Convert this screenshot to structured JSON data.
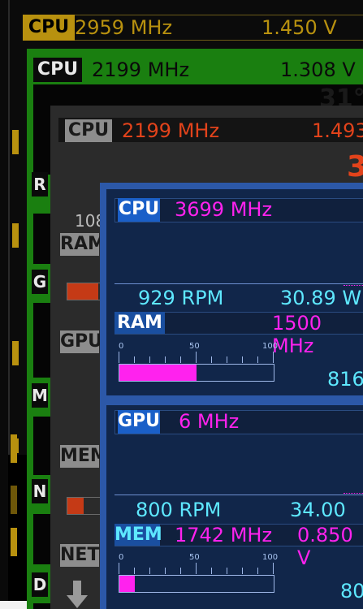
{
  "gold": {
    "cpu_label": "CPU",
    "cpu_clock": "2959 MHz",
    "cpu_voltage": "1.450 V"
  },
  "green": {
    "cpu_label": "CPU",
    "cpu_clock": "2199 MHz",
    "cpu_voltage": "1.308 V",
    "temp_partial": "31°",
    "side_letters": [
      "R",
      "G",
      "M",
      "N",
      "D"
    ]
  },
  "gray": {
    "cpu_label": "CPU",
    "cpu_clock": "2199 MHz",
    "cpu_voltage": "1.493",
    "temp_partial": "3",
    "partial_value": "108",
    "ram_label": "RAM",
    "gpu_label": "GPU",
    "mem_label": "MEM",
    "net_label": "NET",
    "ram_fill": 0.18,
    "mem_fill": 0.14
  },
  "blue": {
    "cpu_label": "CPU",
    "cpu_clock": "3699 MHz",
    "cpu_fan": "929 RPM",
    "cpu_power": "30.89 W",
    "ram_label": "RAM",
    "ram_clock": "1500 MHz",
    "ram_value_partial": "816",
    "ram_fill": 0.5,
    "gpu_label": "GPU",
    "gpu_clock": "6 MHz",
    "gpu_fan": "800 RPM",
    "gpu_power": "34.00 W",
    "mem_label": "MEM",
    "mem_clock": "1742 MHz",
    "mem_voltage": "0.850 V",
    "mem_value_partial": "80",
    "mem_fill": 0.1,
    "scale_labels": [
      "0",
      "50",
      "100"
    ]
  },
  "colors": {
    "gold": "#b8910f",
    "green": "#1a7f10",
    "gray": "#8d8d8d",
    "blue": "#2c58a8",
    "magenta": "#ff22ee",
    "cyan": "#5ee8ff",
    "red": "#e2431b"
  }
}
